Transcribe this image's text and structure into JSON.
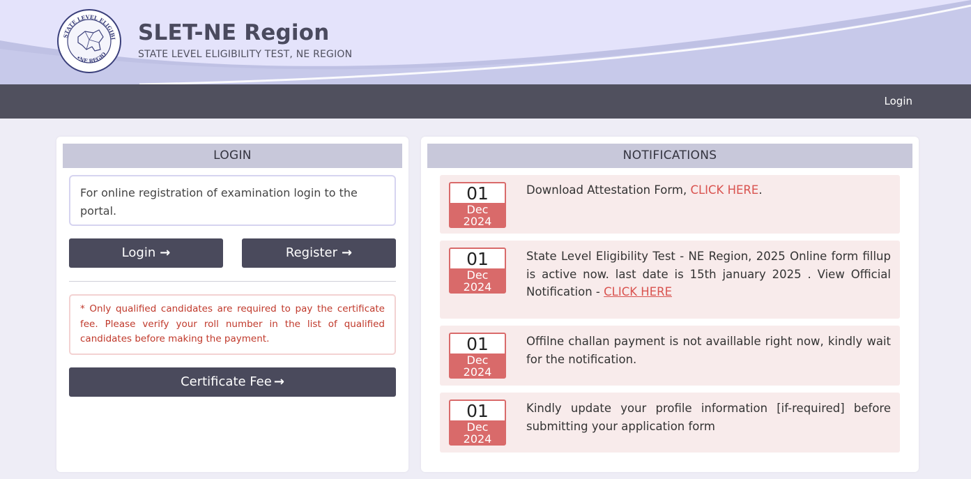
{
  "header": {
    "title": "SLET-NE Region",
    "subtitle": "STATE LEVEL ELIGIBILITY TEST, NE REGION",
    "logo_icon": "seal-logo-icon"
  },
  "nav": {
    "login_label": "Login"
  },
  "login_panel": {
    "heading": "LOGIN",
    "info_text": "For online registration of examination login to the portal.",
    "login_button": "Login",
    "register_button": "Register",
    "warning_text": "* Only qualified candidates are required to pay the certificate fee. Please verify your roll number in the list of qualified candidates before making the payment.",
    "certificate_button": "Certificate Fee",
    "arrow_icon": "→"
  },
  "notifications_panel": {
    "heading": "NOTIFICATIONS",
    "items": [
      {
        "day": "01",
        "month": "Dec",
        "year": "2024",
        "text": "Download Attestation Form, ",
        "link": "CLICK HERE",
        "after": "."
      },
      {
        "day": "01",
        "month": "Dec",
        "year": "2024",
        "text": "State Level Eligibility Test - NE Region, 2025 Online form fillup is active now. last date is 15th january 2025 . View Official Notification - ",
        "link": "CLICK HERE",
        "after": ""
      },
      {
        "day": "01",
        "month": "Dec",
        "year": "2024",
        "text": "Offilne challan payment is not availlable right now, kindly wait for the notification.",
        "link": "",
        "after": ""
      },
      {
        "day": "01",
        "month": "Dec",
        "year": "2024",
        "text": "Kindly update your profile information [if-required] before submitting your application form",
        "link": "",
        "after": ""
      }
    ]
  },
  "colors": {
    "header_bg": "#e4e3fb",
    "nav_bg": "#50505e",
    "button_bg": "#4a4a5c",
    "badge_red": "#d96a6a",
    "link_red": "#d9534f",
    "notice_bg": "#f8ebeb"
  }
}
